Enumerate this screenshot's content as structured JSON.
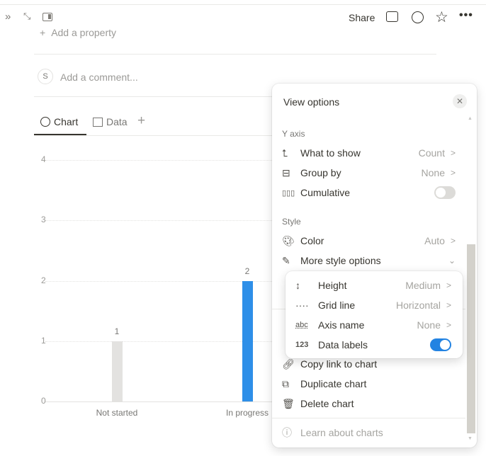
{
  "topbar": {
    "share": "Share",
    "icons": [
      "comment-icon",
      "clock-icon",
      "star-icon",
      "more-icon"
    ]
  },
  "page": {
    "add_property": "Add a property",
    "comment_avatar": "S",
    "comment_placeholder": "Add a comment..."
  },
  "tabs": [
    {
      "label": "Chart",
      "icon": "chart-icon",
      "active": true
    },
    {
      "label": "Data",
      "icon": "table-icon"
    }
  ],
  "chart_data": {
    "type": "bar",
    "categories": [
      "Not started",
      "In progress"
    ],
    "values": [
      1,
      2
    ],
    "colors": [
      "#e3e2e0",
      "#2e8fe8"
    ],
    "yticks": [
      "0",
      "1",
      "2",
      "3",
      "4"
    ],
    "ylim": [
      0,
      4
    ],
    "grid": "horizontal",
    "data_labels": true
  },
  "panel": {
    "title": "View options",
    "y_axis_label": "Y axis",
    "y_axis": [
      {
        "label": "What to show",
        "value": "Count"
      },
      {
        "label": "Group by",
        "value": "None"
      },
      {
        "label": "Cumulative",
        "toggle": false
      }
    ],
    "style_label": "Style",
    "style": [
      {
        "label": "Color",
        "value": "Auto"
      },
      {
        "label": "More style options"
      }
    ],
    "submenu": [
      {
        "label": "Height",
        "value": "Medium"
      },
      {
        "label": "Grid line",
        "value": "Horizontal"
      },
      {
        "label": "Axis name",
        "value": "None"
      },
      {
        "label": "Data labels",
        "toggle": true,
        "icon_text": "123",
        "abc": "abc"
      }
    ],
    "actions": [
      {
        "label": "Copy link to chart"
      },
      {
        "label": "Duplicate chart"
      },
      {
        "label": "Delete chart"
      }
    ],
    "learn": "Learn about charts"
  },
  "colors": {
    "accent": "#2383e2"
  }
}
